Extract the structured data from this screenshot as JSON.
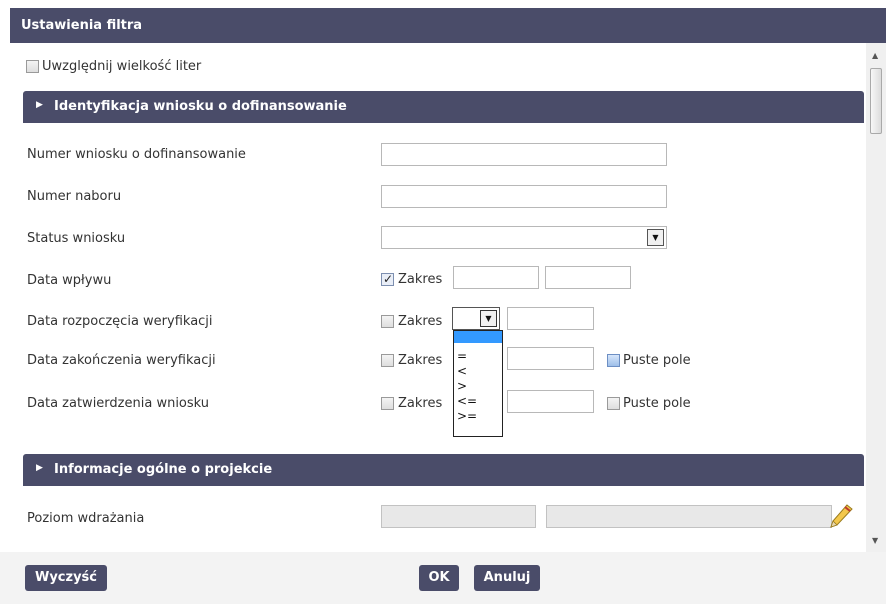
{
  "title": "Ustawienia filtra",
  "case_sensitive": {
    "label": "Uwzględnij wielkość liter",
    "checked": false
  },
  "sections": [
    {
      "title": "Identyfikacja wniosku o dofinansowanie"
    },
    {
      "title": "Informacje ogólne o projekcie"
    }
  ],
  "fields": {
    "numer_wniosku": {
      "label": "Numer wniosku o dofinansowanie",
      "value": ""
    },
    "numer_naboru": {
      "label": "Numer naboru",
      "value": ""
    },
    "status_wniosku": {
      "label": "Status wniosku",
      "value": ""
    },
    "data_wplywu": {
      "label": "Data wpływu",
      "range_label": "Zakres",
      "range_checked": true
    },
    "data_rozpoczecia": {
      "label": "Data rozpoczęcia weryfikacji",
      "range_label": "Zakres",
      "range_checked": false
    },
    "data_zakonczenia": {
      "label": "Data zakończenia weryfikacji",
      "range_label": "Zakres",
      "range_checked": false,
      "empty_label": "Puste pole"
    },
    "data_zatwierdzenia": {
      "label": "Data zatwierdzenia wniosku",
      "range_label": "Zakres",
      "range_checked": false,
      "empty_label": "Puste pole"
    },
    "poziom_wdrazania": {
      "label": "Poziom wdrażania"
    }
  },
  "operator_dropdown": {
    "options": [
      "",
      "=",
      "<",
      ">",
      "<=",
      ">="
    ],
    "selected_index": 0
  },
  "buttons": {
    "clear": "Wyczyść",
    "ok": "OK",
    "cancel": "Anuluj"
  },
  "icons": {
    "edit": "pencil-icon",
    "scroll_up": "arrow-up-icon",
    "scroll_down": "arrow-down-icon",
    "section_expand": "triangle-right-icon",
    "select_open": "chevron-down-icon"
  },
  "colors": {
    "header": "#4a4c69",
    "selection": "#3399ff"
  }
}
